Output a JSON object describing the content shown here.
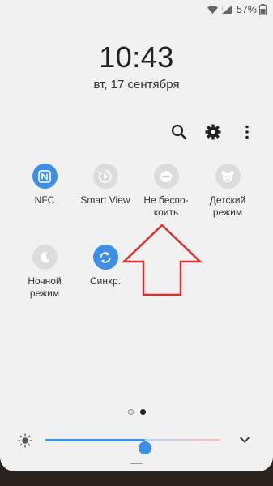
{
  "status": {
    "battery_percent": "57%",
    "icons": [
      "wifi-icon",
      "signal-icon",
      "battery-icon"
    ]
  },
  "clock": {
    "time": "10:43",
    "date": "вт, 17 сентября"
  },
  "actions": [
    "search-icon",
    "gear-icon",
    "more-vertical-icon"
  ],
  "tiles": [
    {
      "label": "NFC",
      "icon": "nfc-icon",
      "active": true
    },
    {
      "label": "Smart View",
      "icon": "smart-view-icon",
      "active": false
    },
    {
      "label": "Не беспо-\nкоить",
      "icon": "do-not-disturb-icon",
      "active": false
    },
    {
      "label": "Детский\nрежим",
      "icon": "kids-mode-icon",
      "active": false
    },
    {
      "label": "Ночной\nрежим",
      "icon": "night-mode-icon",
      "active": false
    },
    {
      "label": "Синхр.",
      "icon": "sync-icon",
      "active": true
    }
  ],
  "pager": {
    "pages": 2,
    "current": 2
  },
  "brightness": {
    "level": 0.57
  },
  "colors": {
    "accent": "#3e8ee6",
    "panel": "#f1f1f1",
    "annotation_arrow": "#d9302c"
  }
}
